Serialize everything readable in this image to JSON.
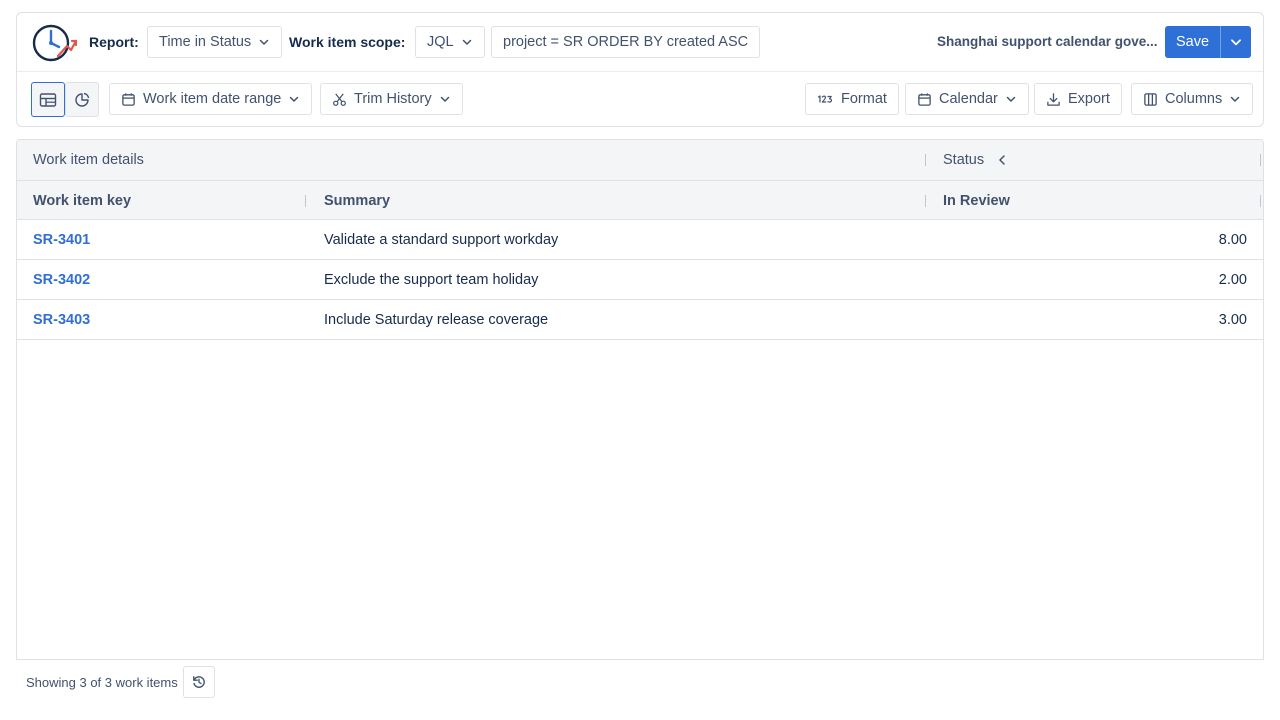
{
  "header": {
    "report_label": "Report:",
    "report_value": "Time in Status",
    "scope_label": "Work item scope:",
    "scope_type": "JQL",
    "jql_query": "project = SR ORDER BY created ASC",
    "calendar_name": "Shanghai support calendar gove...",
    "save_label": "Save"
  },
  "toolbar": {
    "date_range_label": "Work item date range",
    "trim_history_label": "Trim History",
    "format_label": "Format",
    "calendar_label": "Calendar",
    "export_label": "Export",
    "columns_label": "Columns"
  },
  "table": {
    "group_headers": {
      "details": "Work item details",
      "status": "Status"
    },
    "columns": {
      "key": "Work item key",
      "summary": "Summary",
      "in_review": "In Review"
    },
    "rows": [
      {
        "key": "SR-3401",
        "summary": "Validate a standard support workday",
        "in_review": "8.00"
      },
      {
        "key": "SR-3402",
        "summary": "Exclude the support team holiday",
        "in_review": "2.00"
      },
      {
        "key": "SR-3403",
        "summary": "Include Saturday release coverage",
        "in_review": "3.00"
      }
    ]
  },
  "footer": {
    "showing_text": "Showing 3 of 3 work items"
  },
  "colors": {
    "accent": "#2f6fd8",
    "border": "#dfe1e6",
    "header_bg": "#f4f5f7"
  },
  "icons": [
    "app-logo-icon",
    "chevron-down-icon",
    "table-view-icon",
    "chart-view-icon",
    "calendar-icon",
    "scissors-icon",
    "number-format-icon",
    "download-icon",
    "columns-icon",
    "chevron-left-icon",
    "refresh-icon"
  ]
}
